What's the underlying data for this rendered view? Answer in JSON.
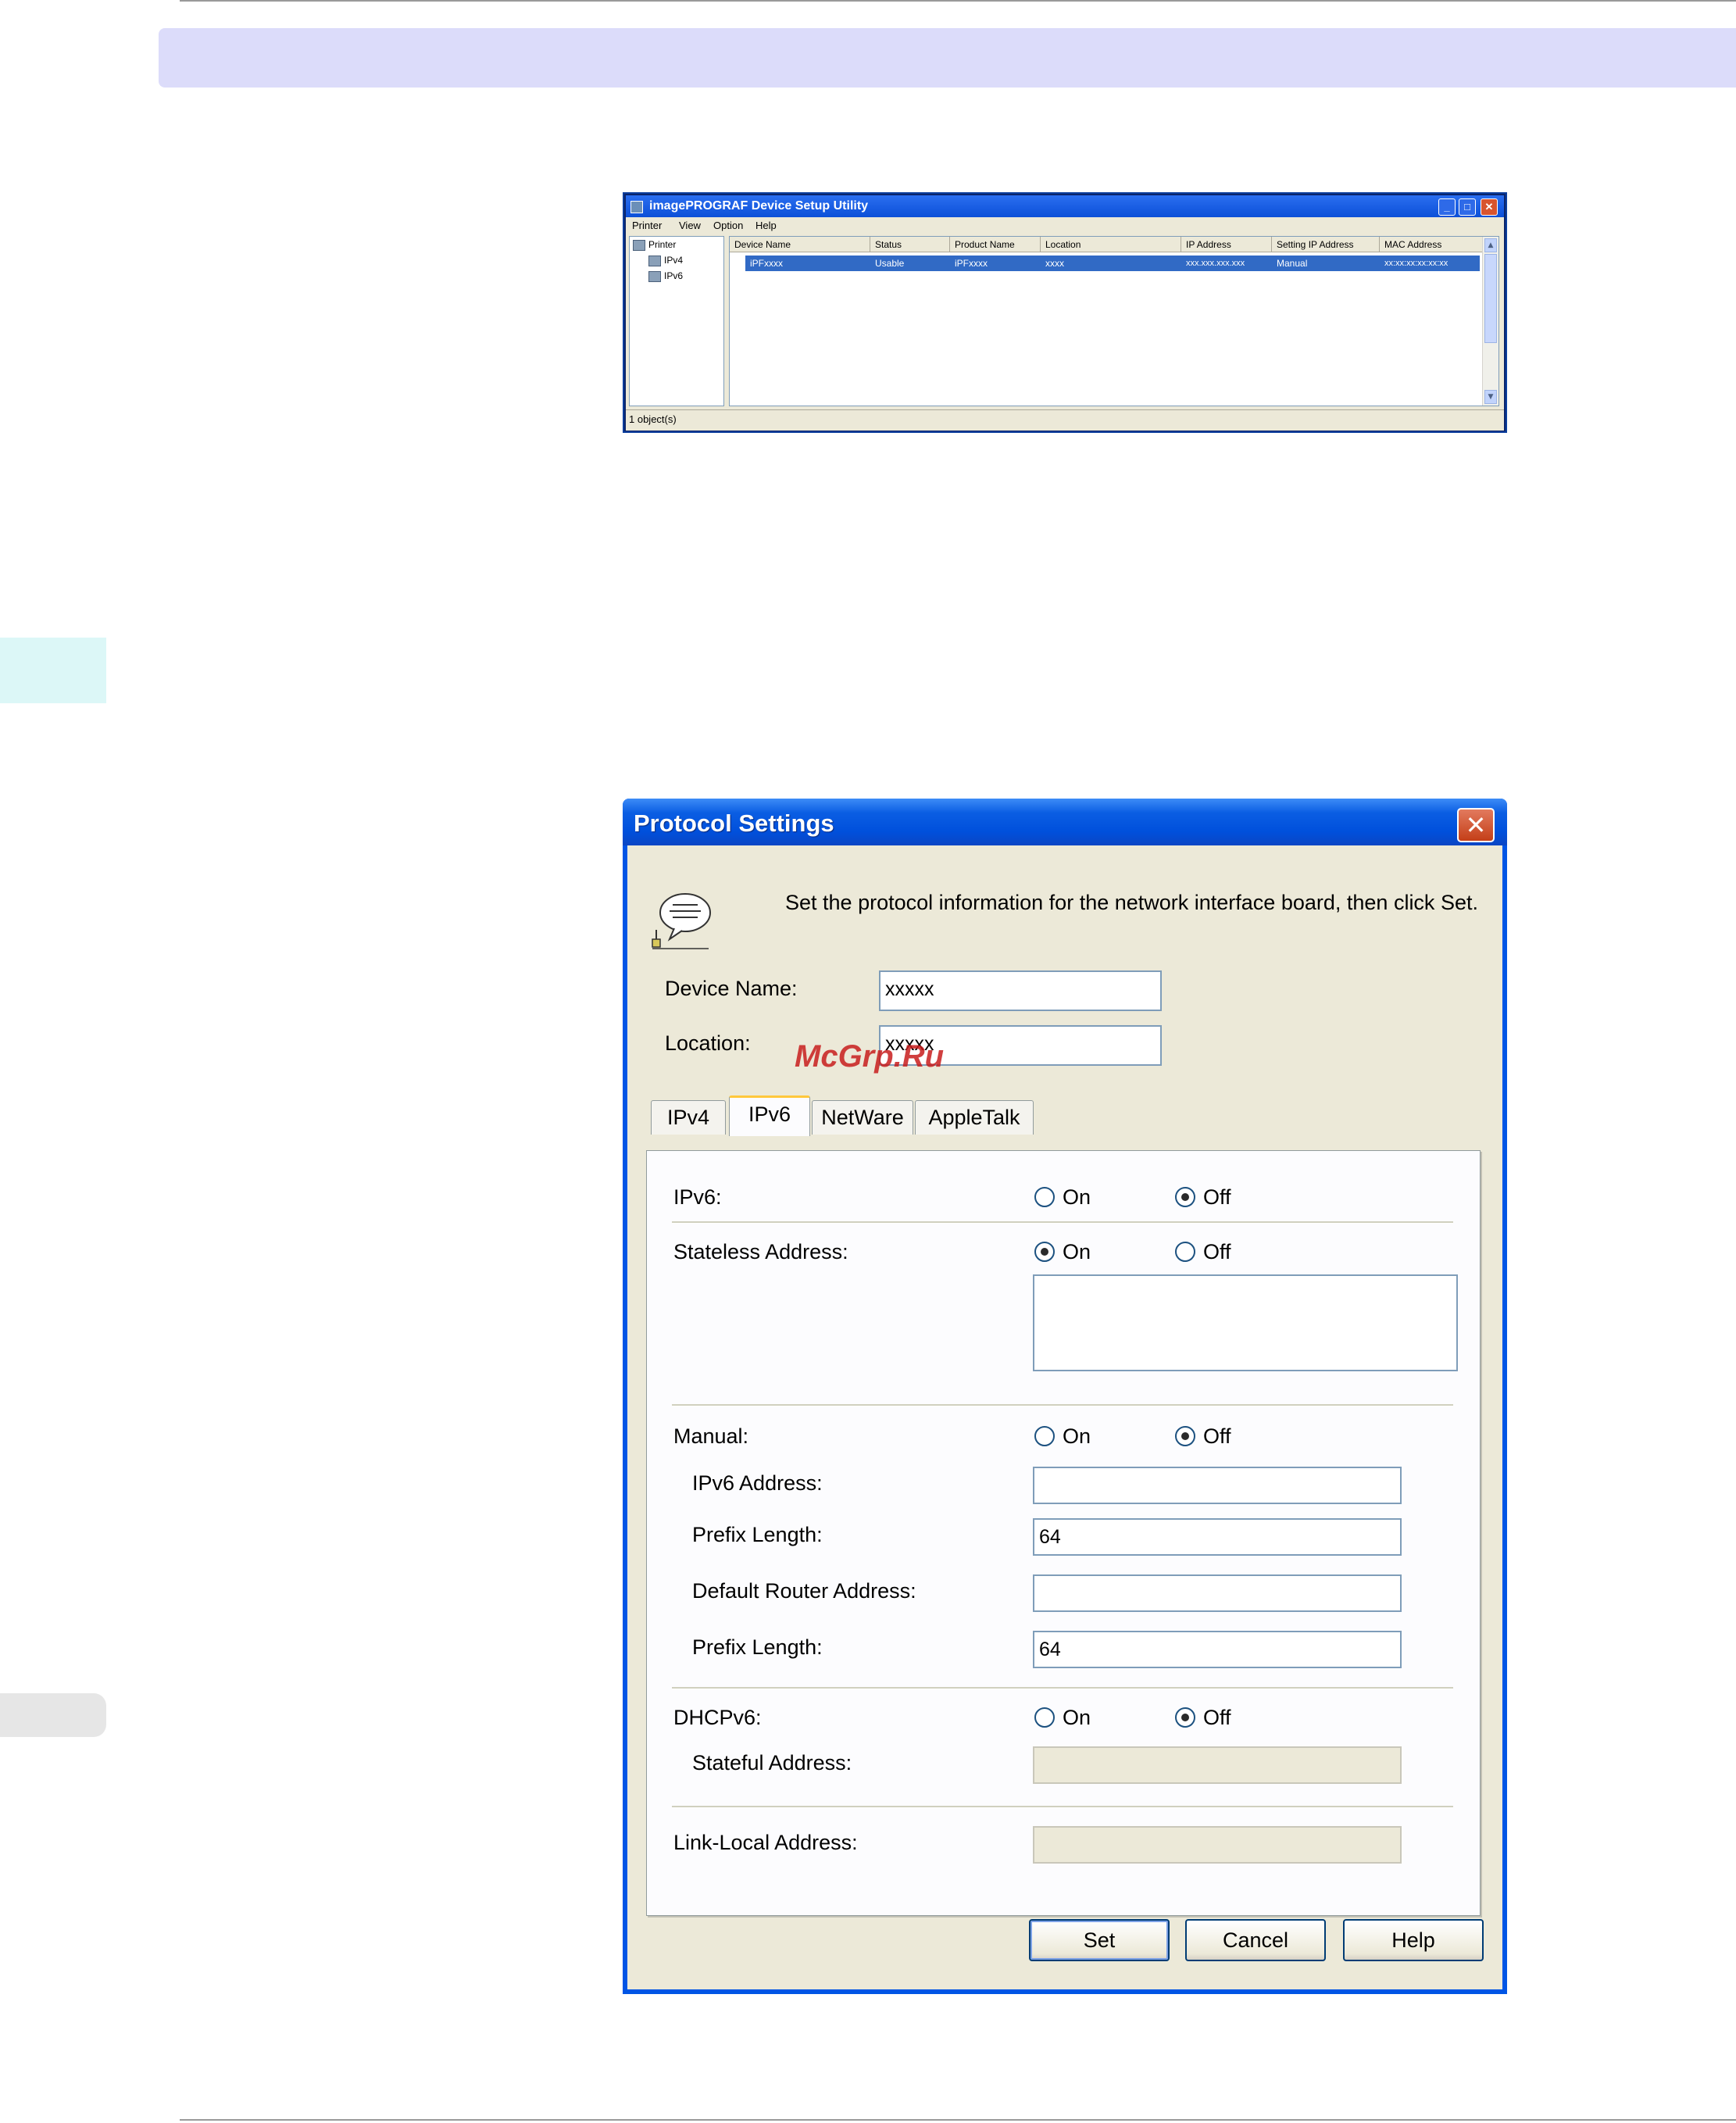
{
  "watermark": "McGrp.Ru",
  "device_setup_window": {
    "title": "imagePROGRAF Device Setup Utility",
    "menu": [
      "Printer",
      "View",
      "Option",
      "Help"
    ],
    "tree": {
      "root": "Printer",
      "children": [
        "IPv4",
        "IPv6"
      ]
    },
    "columns": [
      "Device Name",
      "Status",
      "Product Name",
      "Location",
      "IP Address",
      "Setting IP Address",
      "MAC Address"
    ],
    "rows": [
      [
        "iPFxxxx",
        "Usable",
        "iPFxxxx",
        "xxxx",
        "xxx.xxx.xxx.xxx",
        "Manual",
        "xx:xx:xx:xx:xx:xx"
      ]
    ],
    "status": "1 object(s)"
  },
  "protocol_dialog": {
    "title": "Protocol Settings",
    "instruction": "Set the protocol information for the network interface board, then click Set.",
    "device_name_label": "Device Name:",
    "device_name_value": "xxxxx",
    "location_label": "Location:",
    "location_value": "xxxxx",
    "tabs": [
      "IPv4",
      "IPv6",
      "NetWare",
      "AppleTalk"
    ],
    "active_tab": "IPv6",
    "on_label": "On",
    "off_label": "Off",
    "ipv6_label": "IPv6:",
    "ipv6_state": "Off",
    "stateless_label": "Stateless Address:",
    "stateless_state": "On",
    "stateless_value": "",
    "manual_label": "Manual:",
    "manual_state": "Off",
    "ipv6_address_label": "IPv6 Address:",
    "ipv6_address_value": "",
    "prefix_length_label": "Prefix Length:",
    "prefix_length_value": "64",
    "default_router_label": "Default Router Address:",
    "default_router_value": "",
    "router_prefix_length_label": "Prefix Length:",
    "router_prefix_length_value": "64",
    "dhcpv6_label": "DHCPv6:",
    "dhcpv6_state": "Off",
    "stateful_label": "Stateful Address:",
    "stateful_value": "",
    "link_local_label": "Link-Local Address:",
    "link_local_value": "",
    "buttons": {
      "set": "Set",
      "cancel": "Cancel",
      "help": "Help"
    }
  }
}
